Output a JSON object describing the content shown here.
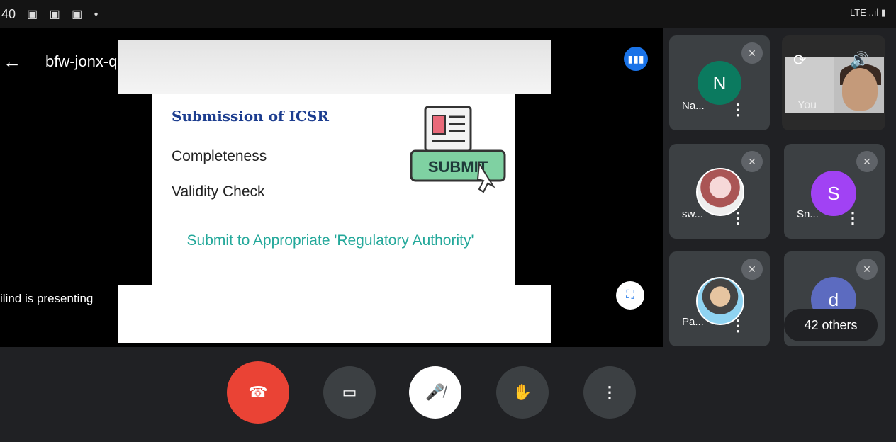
{
  "status_bar": {
    "time": "40",
    "icons_left": "▣ ▣ ▣ •",
    "icons_right": "LTE ..ıl ▮"
  },
  "header": {
    "meeting_code": "bfw-jonx-qui ▸",
    "back_icon": "back-arrow-icon",
    "audio_icon": "audio-level-icon"
  },
  "slide": {
    "title": "Submission of ICSR",
    "items": [
      "Completeness",
      "Validity Check"
    ],
    "subtitle": "Submit to Appropriate 'Regulatory Authority'",
    "graphic_label": "SUBMIT"
  },
  "presenting_label": "ilind is presenting",
  "participants": [
    {
      "name": "Na...",
      "initial": "N",
      "avatar_color": "#0b7a5f",
      "muted": true
    },
    {
      "name": "sw...",
      "initial": "",
      "avatar_color": "photo",
      "muted": true
    },
    {
      "name": "Sn...",
      "initial": "S",
      "avatar_color": "#a142f4",
      "muted": true
    },
    {
      "name": "Pa...",
      "initial": "",
      "avatar_color": "photo",
      "muted": true
    },
    {
      "name": "",
      "initial": "d",
      "avatar_color": "#5c6bc0",
      "muted": true
    }
  ],
  "self_tile": {
    "label": "You"
  },
  "others_label": "42 others",
  "controls": {
    "end_call": "end-call-icon",
    "camera": "camera-icon",
    "mic": "mic-off-icon",
    "raise_hand": "raise-hand-icon",
    "more": "more-options-icon"
  },
  "colors": {
    "end_call": "#ea4335",
    "control_bg": "#3c4043",
    "accent": "#1a73e8"
  }
}
